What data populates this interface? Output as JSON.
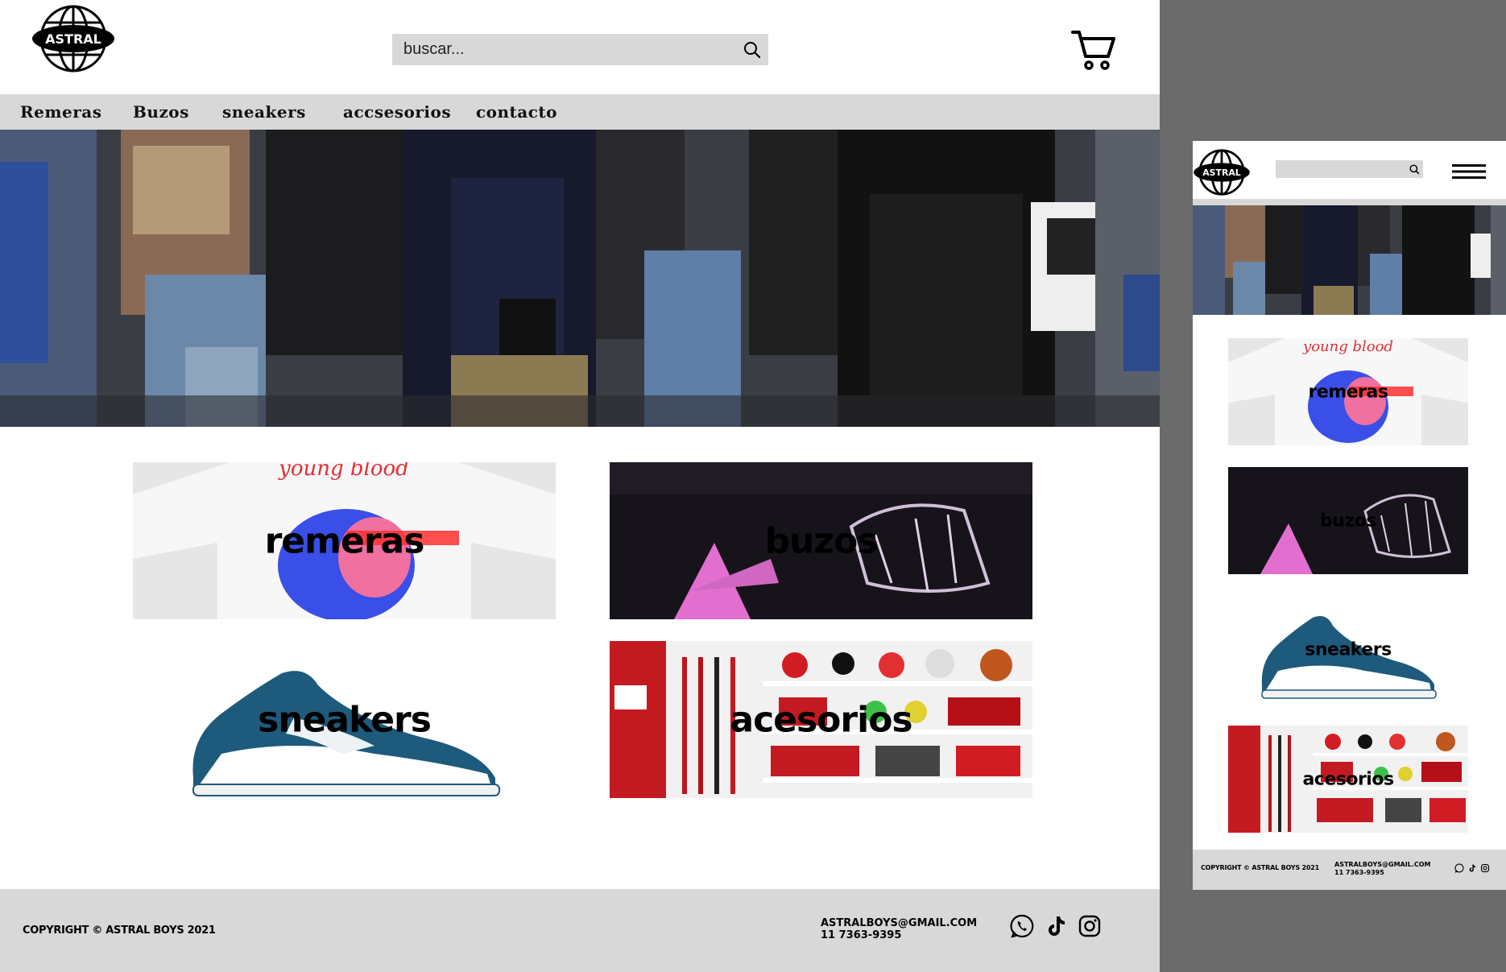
{
  "brand": {
    "logo_text": "ASTRAL"
  },
  "search": {
    "placeholder": "buscar..."
  },
  "nav": {
    "items": [
      {
        "label": "Remeras"
      },
      {
        "label": "Buzos"
      },
      {
        "label": "sneakers"
      },
      {
        "label": "accsesorios"
      },
      {
        "label": "contacto"
      }
    ]
  },
  "categories": [
    {
      "label": "remeras"
    },
    {
      "label": "buzos"
    },
    {
      "label": "sneakers"
    },
    {
      "label": "acesorios"
    }
  ],
  "footer": {
    "copyright": "COPYRIGHT © ASTRAL BOYS 2021",
    "email": "ASTRALBOYS@GMAIL.COM",
    "phone": "11 7363-9395"
  },
  "icons": [
    "search-icon",
    "cart-icon",
    "whatsapp-icon",
    "tiktok-icon",
    "instagram-icon",
    "hamburger-icon"
  ],
  "colors": {
    "nav_bg": "#d8d8d8",
    "backdrop": "#6b6b6b"
  }
}
